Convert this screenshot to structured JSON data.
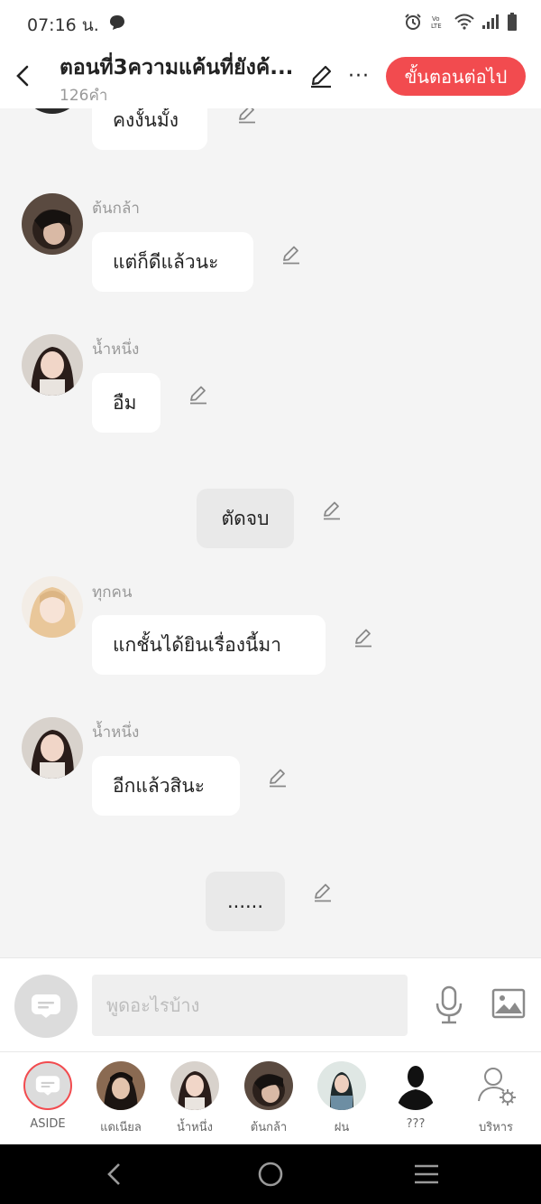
{
  "status_bar": {
    "time": "07:16 น.",
    "icons": [
      "chat-bubble-icon",
      "alarm-icon",
      "volte-icon",
      "wifi-icon",
      "signal-icon",
      "battery-icon"
    ],
    "volte_text": "Vo\nLTE"
  },
  "header": {
    "title": "ตอนที่3ความแค้นที่ยังค้...",
    "word_count": "126คำ",
    "next_button": "ขั้นตอนต่อไป",
    "accent_color": "#f24b4f"
  },
  "messages": [
    {
      "speaker": "",
      "text": "คงงั้นมั้ง"
    },
    {
      "speaker": "ต้นกล้า",
      "text": "แต่ก็ดีแล้วนะ"
    },
    {
      "speaker": "น้ำหนึ่ง",
      "text": "อืม"
    },
    {
      "speaker": "",
      "text": "ตัดจบ"
    },
    {
      "speaker": "ทุกคน",
      "text": "แกชั้นได้ยินเรื่องนี้มา"
    },
    {
      "speaker": "น้ำหนึ่ง",
      "text": "อีกแล้วสินะ"
    },
    {
      "speaker": "",
      "text": "......"
    }
  ],
  "composer": {
    "placeholder": "พูดอะไรบ้าง",
    "value": ""
  },
  "characters": [
    {
      "label": "ASIDE"
    },
    {
      "label": "แดเนียล"
    },
    {
      "label": "น้ำหนึ่ง"
    },
    {
      "label": "ต้นกล้า"
    },
    {
      "label": "ฝน"
    },
    {
      "label": "???"
    },
    {
      "label": "บริหาร"
    }
  ]
}
